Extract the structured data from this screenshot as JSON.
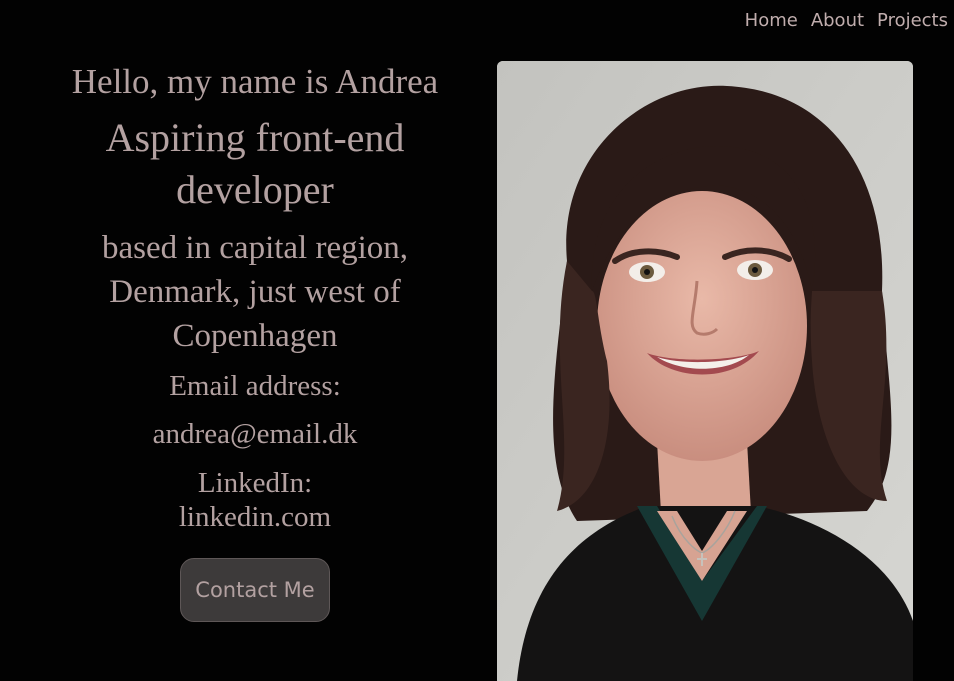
{
  "nav": {
    "items": [
      {
        "label": "Home"
      },
      {
        "label": "About"
      },
      {
        "label": "Projects"
      }
    ]
  },
  "hero": {
    "greeting": "Hello, my name is Andrea",
    "role": "Aspiring front-end developer",
    "location": "based in capital region, Denmark, just west of Copenhagen",
    "email_label": "Email address:",
    "email": "andrea@email.dk",
    "linkedin_label": "LinkedIn:",
    "linkedin": "linkedin.com",
    "contact_button": "Contact Me"
  },
  "colors": {
    "background": "#020202",
    "text": "#b3a1a1",
    "button_bg": "#3d3a3a",
    "photo_backdrop": "#c9c9c6"
  }
}
